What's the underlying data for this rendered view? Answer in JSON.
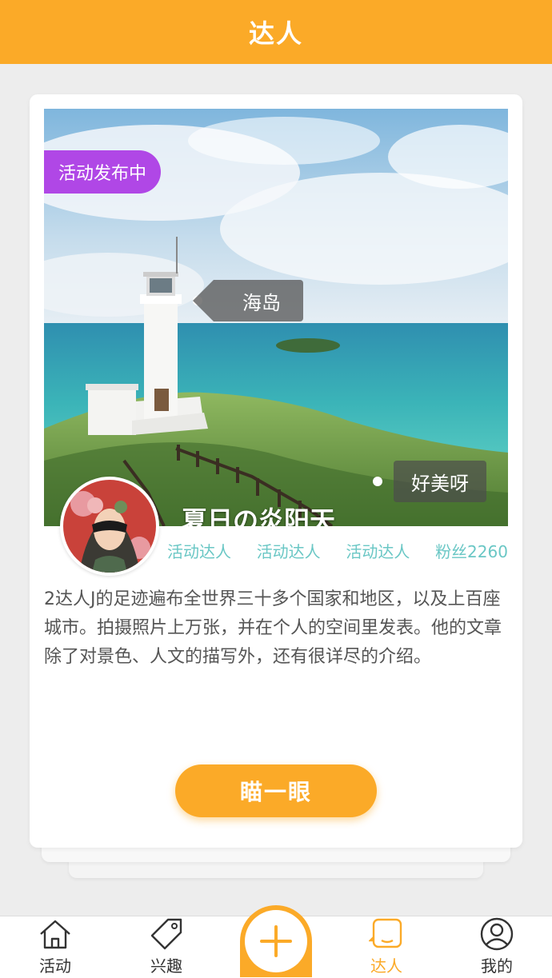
{
  "header": {
    "title": "达人"
  },
  "card": {
    "status_badge": "活动发布中",
    "photo_tags": [
      "海岛",
      "好美呀"
    ],
    "title": "夏日の炎阳天",
    "stats": [
      "活动达人",
      "活动达人",
      "活动达人",
      "粉丝2260"
    ],
    "description": "2达人J的足迹遍布全世界三十多个国家和地区，以及上百座城市。拍摄照片上万张，并在个人的空间里发表。他的文章除了对景色、人文的描写外，还有很详尽的介绍。",
    "cta_label": "瞄一眼"
  },
  "tabbar": {
    "items": [
      {
        "label": "活动",
        "icon": "home-icon"
      },
      {
        "label": "兴趣",
        "icon": "tag-icon"
      },
      {
        "label": "",
        "icon": "plus-icon"
      },
      {
        "label": "达人",
        "icon": "expert-icon",
        "active": true
      },
      {
        "label": "我的",
        "icon": "user-icon"
      }
    ]
  },
  "colors": {
    "accent": "#fbaa28",
    "badge": "#b047e6",
    "stats": "#6ac7c5"
  }
}
